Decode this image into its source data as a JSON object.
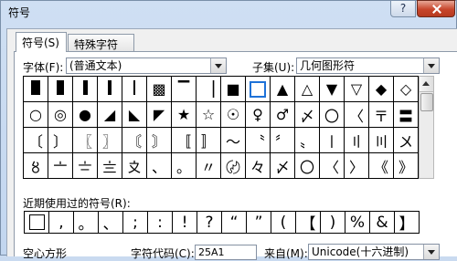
{
  "window": {
    "title": "符号",
    "help_label": "?"
  },
  "tabs": [
    {
      "label": "符号(S)"
    },
    {
      "label": "特殊字符(P)"
    }
  ],
  "font": {
    "label": "字体(F):",
    "value": "(普通文本)"
  },
  "subset": {
    "label": "子集(U):",
    "value": "几何图形符"
  },
  "symbols": [
    [
      "glyph:black-tall-rect",
      "glyph:black-rect",
      "glyph:thin-bar",
      "glyph:bar",
      "glyph:thin-line",
      "▩",
      "▔",
      "▕",
      "■",
      "□",
      "▲",
      "△",
      "▼",
      "▽",
      "◆",
      "◇"
    ],
    [
      "○",
      "◎",
      "●",
      "◢",
      "◣",
      "◤",
      "★",
      "☆",
      "☉",
      "♀",
      "♂",
      "〆",
      "〇",
      "〈",
      "〒",
      "〓"
    ],
    [
      "〔",
      "〕",
      "〖",
      "〗",
      "〘",
      "〙",
      "〚",
      "〛",
      "〜",
      "〝",
      "〞",
      "〟",
      "〡",
      "〢",
      "〣",
      "〤"
    ],
    [
      "〥",
      "〦",
      "〧",
      "〨",
      "〩",
      "、",
      "。",
      "〃",
      "〄",
      "々",
      "〆",
      "〇",
      "〈",
      "〉",
      "《",
      "》"
    ]
  ],
  "recent": {
    "label": "近期使用过的符号(R):",
    "items": [
      "□",
      ",",
      "。",
      "、",
      ";",
      ":",
      "!",
      "?",
      "“",
      "”",
      "(",
      "【",
      ")",
      "%",
      "&",
      "】"
    ]
  },
  "bottom": {
    "char_name": "空心方形",
    "code_label": "字符代码(C):",
    "code_value": "25A1",
    "from_label": "来自(M):",
    "from_value": "Unicode(十六进制)"
  }
}
